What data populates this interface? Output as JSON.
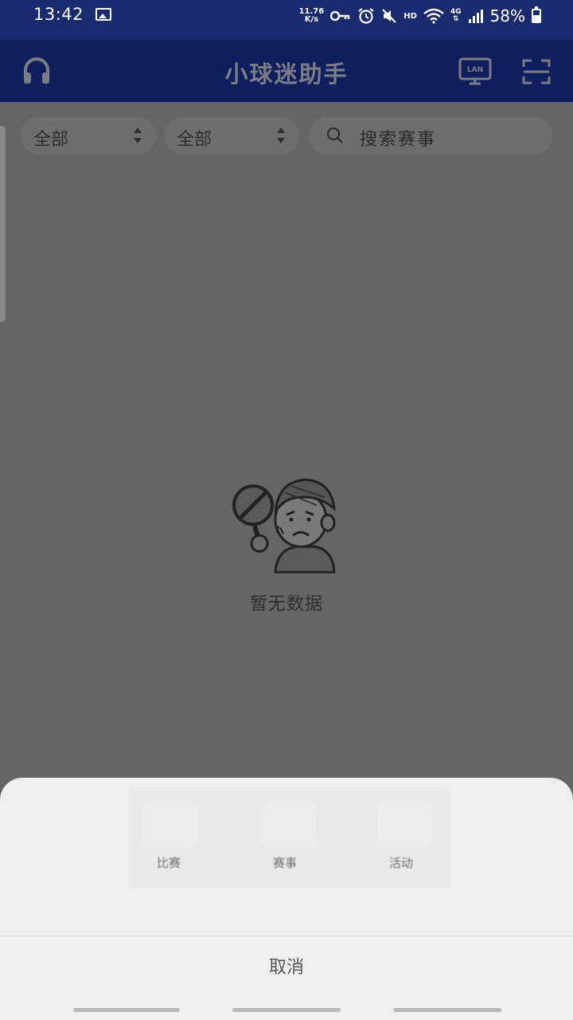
{
  "status_bar": {
    "time": "13:42",
    "net_speed_value": "11.76",
    "net_speed_unit": "K/s",
    "hd_label": "HD",
    "network_label": "4G",
    "battery": "58%",
    "icons": [
      "image-icon",
      "vpn-key-icon",
      "alarm-icon",
      "mute-icon",
      "wifi-icon",
      "signal-icon",
      "battery-icon"
    ]
  },
  "app_bar": {
    "title": "小球迷助手",
    "lan_label": "LAN",
    "icons": [
      "headset-icon",
      "lan-tv-icon",
      "scan-icon"
    ]
  },
  "filters": {
    "filter1_label": "全部",
    "filter2_label": "全部",
    "search_placeholder": "搜索赛事"
  },
  "empty_state": {
    "message": "暂无数据"
  },
  "share_sheet": {
    "items": [
      {
        "label": "比赛"
      },
      {
        "label": "赛事"
      },
      {
        "label": "活动"
      }
    ],
    "cancel_label": "取消"
  },
  "colors": {
    "status_bar_bg": "#1a2a6e",
    "app_bar_bg": "#0f1f5e",
    "overlay_bg": "#656565",
    "sheet_bg": "#efefef"
  }
}
